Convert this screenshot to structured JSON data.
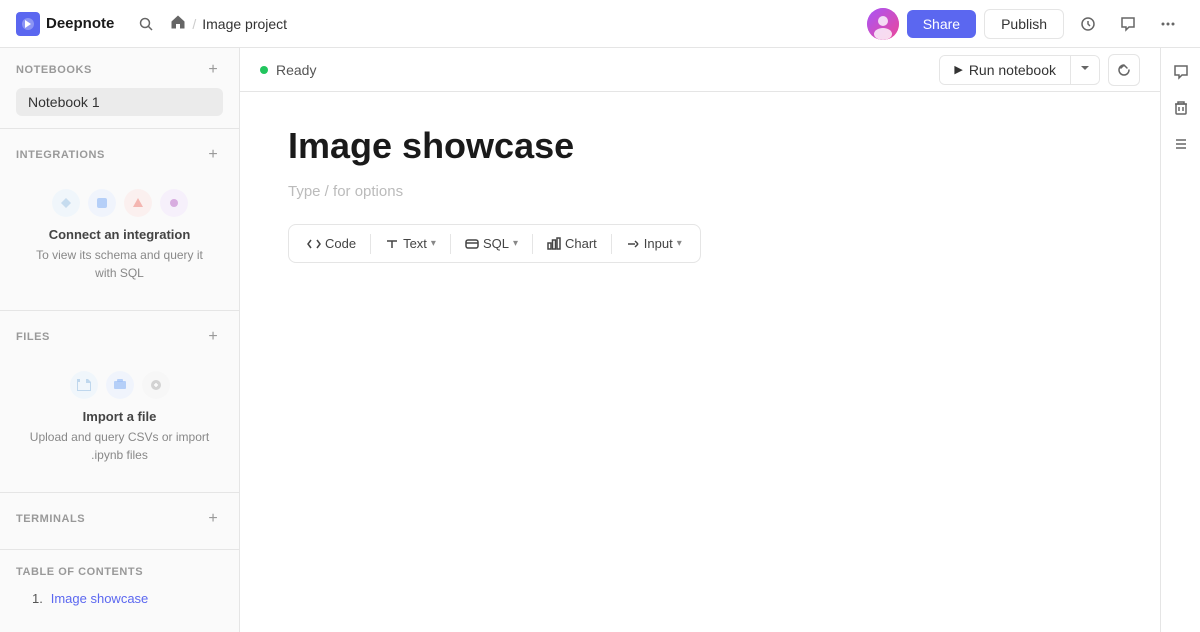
{
  "app": {
    "name": "Deepnote",
    "logo_letter": "D"
  },
  "topbar": {
    "home_icon": "🏠",
    "breadcrumb_sep": "/",
    "project_name": "Image project",
    "share_label": "Share",
    "publish_label": "Publish"
  },
  "sidebar": {
    "notebooks_section": "NOTEBOOKS",
    "notebook_item": "Notebook 1",
    "integrations_section": "INTEGRATIONS",
    "integrations_title": "Connect an integration",
    "integrations_desc": "To view its schema and query it with SQL",
    "files_section": "FILES",
    "files_title": "Import a file",
    "files_desc": "Upload and query CSVs or import .ipynb files",
    "terminals_section": "TERMINALS",
    "toc_section": "TABLE OF CONTENTS",
    "toc_items": [
      {
        "number": "1.",
        "label": "Image showcase"
      }
    ]
  },
  "status": {
    "dot_color": "#22c55e",
    "text": "Ready",
    "run_btn_label": "Run notebook",
    "run_icon": "▶"
  },
  "notebook": {
    "title": "Image showcase",
    "placeholder": "Type / for options"
  },
  "cell_toolbar": {
    "buttons": [
      {
        "icon": "code",
        "label": "Code"
      },
      {
        "icon": "text",
        "label": "Text",
        "has_dropdown": true
      },
      {
        "icon": "sql",
        "label": "SQL",
        "has_dropdown": true
      },
      {
        "icon": "chart",
        "label": "Chart"
      },
      {
        "icon": "input",
        "label": "Input",
        "has_dropdown": true
      }
    ]
  },
  "right_sidebar": {
    "icons": [
      "comment",
      "trash",
      "list"
    ]
  },
  "colors": {
    "accent": "#5b67f0",
    "status_green": "#22c55e",
    "border": "#e5e5e5"
  }
}
